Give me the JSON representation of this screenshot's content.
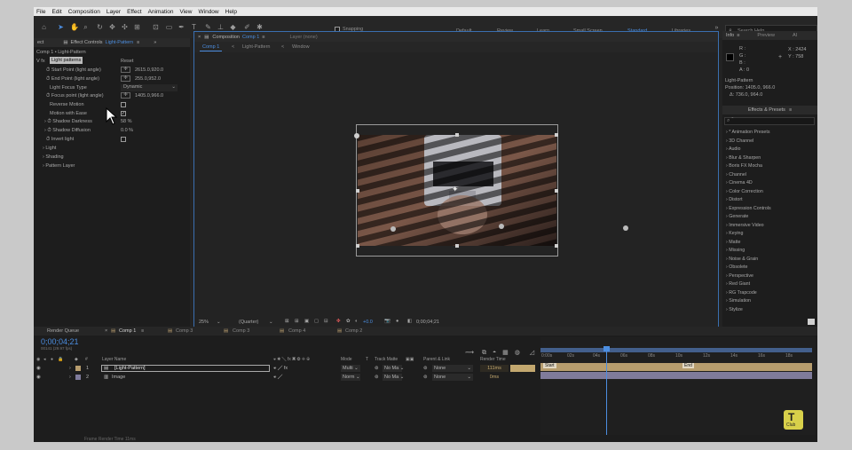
{
  "menu": [
    "File",
    "Edit",
    "Composition",
    "Layer",
    "Effect",
    "Animation",
    "View",
    "Window",
    "Help"
  ],
  "toolbar": {
    "snapping": "Snapping",
    "workspaces": [
      "Default",
      "Review",
      "Learn",
      "Small Screen",
      "Standard",
      "Libraries"
    ],
    "active_workspace": "Standard",
    "search_placeholder": "Search Help"
  },
  "effect_controls": {
    "tab_prefix": "ect",
    "tab_label": "Effect Controls",
    "tab_target": "Light-Pattern",
    "breadcrumb": "Comp 1 • Light-Pattern",
    "effect_name": "Light patterns",
    "reset": "Reset",
    "properties": [
      {
        "label": "Start Point (light angle)",
        "value": "2615.0,920.0"
      },
      {
        "label": "End Point (light angle)",
        "value": "255.0,952.0"
      },
      {
        "label": "Light Focus Type",
        "value": "Dynamic"
      },
      {
        "label": "Focus point (light angle)",
        "value": "1405.0,966.0"
      },
      {
        "label": "Reverse Motion",
        "value": ""
      },
      {
        "label": "Motion with Ease",
        "value": ""
      },
      {
        "label": "Shadow Darkness",
        "value": "58 %"
      },
      {
        "label": "Shadow Diffusion",
        "value": "0.0 %"
      },
      {
        "label": "Invert light",
        "value": ""
      }
    ],
    "groups": [
      "Light",
      "Shading",
      "Pattern Layer"
    ]
  },
  "composition": {
    "tab_label": "Composition",
    "tab_target": "Comp 1",
    "layer_tab": "Layer  (none)",
    "breadcrumbs": [
      "Comp 1",
      "Light-Pattern",
      "Window"
    ],
    "zoom": "25%",
    "resolution": "(Quarter)",
    "exposure": "+0.0",
    "timecode": "0;00;04;21"
  },
  "info": {
    "tabs": [
      "Info",
      "Preview",
      "AI"
    ],
    "rgb": [
      "R :",
      "G :",
      "B :",
      "A :  0"
    ],
    "xy": [
      "X : 2424",
      "Y :  758"
    ],
    "layer": "Light-Pattern",
    "position": "Position: 1405.0, 966.0",
    "delta": "Δ: 736.0, 964.0"
  },
  "effects_presets": {
    "title": "Effects & Presets",
    "items": [
      "* Animation Presets",
      "3D Channel",
      "Audio",
      "Blur & Sharpen",
      "Boris FX Mocha",
      "Channel",
      "Cinema 4D",
      "Color Correction",
      "Distort",
      "Expression Controls",
      "Generate",
      "Immersive Video",
      "Keying",
      "Matte",
      "Missing",
      "Noise & Grain",
      "Obsolete",
      "Perspective",
      "Red Giant",
      "RG Trapcode",
      "Simulation",
      "Stylize"
    ]
  },
  "timeline": {
    "tabs": [
      "Render Queue",
      "Comp 1",
      "Comp 3",
      "Comp 3",
      "Comp 4",
      "Comp 2"
    ],
    "active_tab": "Comp 1",
    "timecode": "0;00;04;21",
    "timecode_sub": "00141 (29.97 fps)",
    "columns": {
      "layer_name": "Layer Name",
      "mode": "Mode",
      "t": "T",
      "track_matte": "Track Matte",
      "parent": "Parent & Link",
      "render_time": "Render Time"
    },
    "layers": [
      {
        "num": "1",
        "name": "[Light-Pattern]",
        "mode": "Multi",
        "matte": "No Ma",
        "parent": "None",
        "render": "111ms"
      },
      {
        "num": "2",
        "name": "Image",
        "mode": "Norm",
        "matte": "No Ma",
        "parent": "None",
        "render": "0ms"
      }
    ],
    "ruler": [
      "0:00s",
      "02s",
      "04s",
      "06s",
      "08s",
      "10s",
      "12s",
      "14s",
      "16s",
      "18s"
    ],
    "markers": [
      "Start",
      "End"
    ],
    "footer": "Frame Render Time  11ms",
    "playhead_fraction": 0.243
  },
  "watermark": "Club",
  "colors": {
    "accent": "#4c8ee0",
    "render_bar": "#c3a86f",
    "layer_bar": "#b79d6e",
    "image_bar": "#7f7b9b"
  }
}
